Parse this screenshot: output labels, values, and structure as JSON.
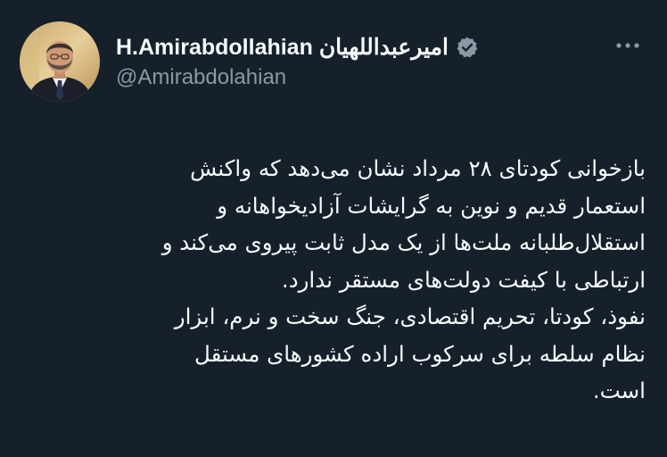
{
  "tweet": {
    "author": {
      "display_name": "H.Amirabdollahian امیرعبداللهیان",
      "handle": "@Amirabdolahian",
      "verified_icon": "verified-badge-icon",
      "avatar_icon": "profile-photo"
    },
    "more_icon": "more-options-icon",
    "text_lines": [
      "بازخوانی کودتای ۲۸ مرداد نشان می‌دهد که واکنش",
      "استعمار قدیم و نوین به گرایشات آزادیخواهانه و",
      "استقلال‌طلبانه ملت‌ها از یک مدل ثابت پیروی می‌کند و",
      "ارتباطی با کیفت دولت‌های مستقر ندارد.",
      "نفوذ، کودتا، تحریم اقتصادی، جنگ سخت و نرم، ابزار",
      "نظام سلطه برای سرکوب اراده کشورهای  مستقل",
      "است."
    ]
  },
  "colors": {
    "background": "#15202b",
    "text_primary": "#f7f9f9",
    "text_secondary": "#8b98a5",
    "verified_badge": "#8b98a5"
  }
}
